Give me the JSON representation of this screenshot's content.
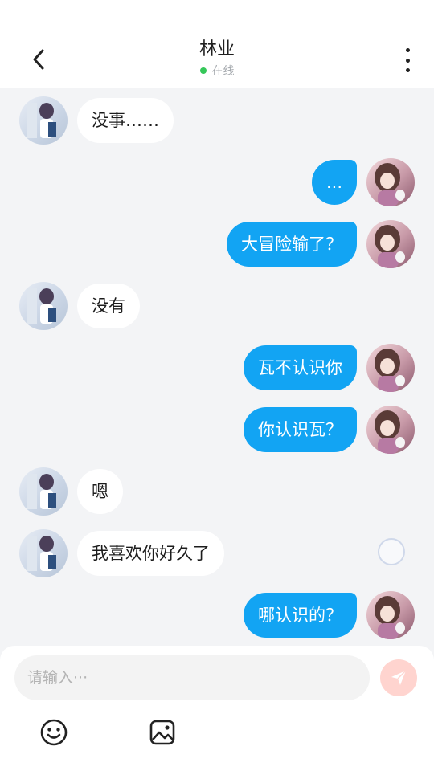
{
  "header": {
    "title": "林业",
    "status_text": "在线",
    "status_color": "#35c759",
    "back_icon": "chevron-left-icon",
    "more_icon": "more-vertical-icon"
  },
  "messages": [
    {
      "side": "left",
      "text": "没事……"
    },
    {
      "side": "right",
      "text": "..."
    },
    {
      "side": "right",
      "text": "大冒险输了？"
    },
    {
      "side": "left",
      "text": "没有"
    },
    {
      "side": "right",
      "text": "瓦不认识你"
    },
    {
      "side": "right",
      "text": "你认识瓦？"
    },
    {
      "side": "left",
      "text": "嗯"
    },
    {
      "side": "left",
      "text": "我喜欢你好久了"
    },
    {
      "side": "right",
      "text": "哪认识的？"
    }
  ],
  "composer": {
    "placeholder": "请输入···",
    "send_icon": "send-icon",
    "emoji_icon": "emoji-icon",
    "image_icon": "image-icon"
  },
  "colors": {
    "outgoing_bubble": "#12a4f3",
    "incoming_bubble": "#ffffff",
    "background": "#f3f4f6",
    "send_button": "#ffd4cf"
  }
}
